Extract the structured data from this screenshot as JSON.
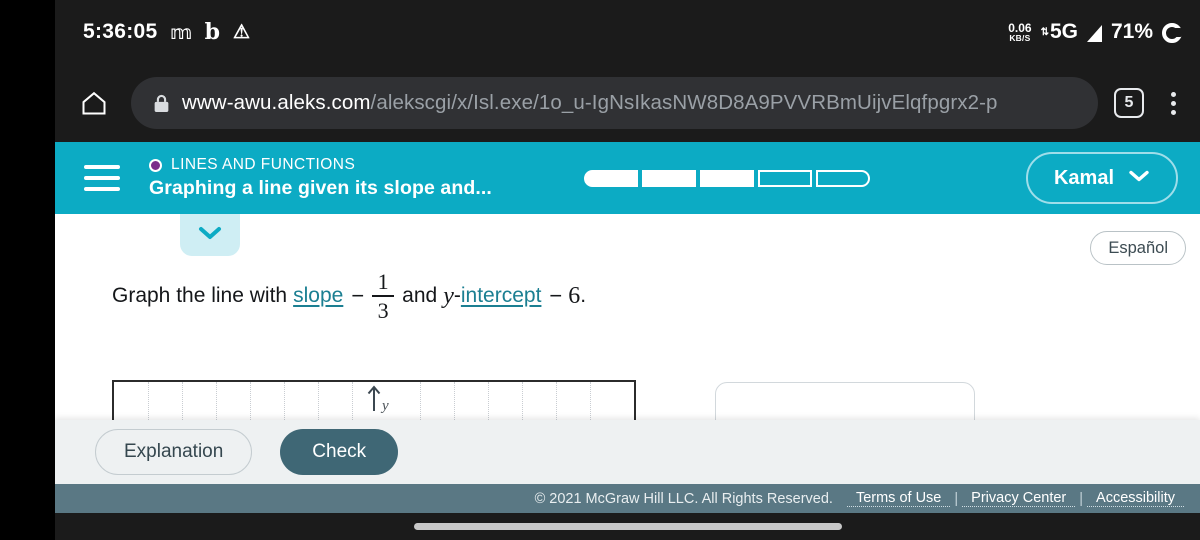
{
  "status_bar": {
    "clock": "5:36:05",
    "icons": [
      "mastodon-icon",
      "b-app-icon",
      "warning-triangle-icon"
    ],
    "net_speed_value": "0.06",
    "net_speed_unit": "KB/S",
    "network_type": "5G",
    "battery_percent": "71%",
    "signal_icon": "signal-triangle-icon",
    "battery_icon": "battery-ring-icon"
  },
  "browser": {
    "home_icon": "home-icon",
    "lock_icon": "lock-icon",
    "url_host": "www-awu.aleks.com",
    "url_path": "/alekscgi/x/Isl.exe/1o_u-IgNsIkasNW8D8A9PVVRBmUijvElqfpgrx2-p",
    "tab_count": "5",
    "menu_icon": "kebab-menu-icon"
  },
  "app_header": {
    "menu_icon": "hamburger-menu-icon",
    "topic_bullet": "purple-dot-icon",
    "topic": "LINES AND FUNCTIONS",
    "problem_title": "Graphing a line given its slope and...",
    "progress": {
      "total": 5,
      "completed": 3,
      "segments": [
        "filled",
        "filled",
        "filled",
        "empty",
        "empty"
      ]
    },
    "user_name": "Kamal",
    "user_chevron": "chevron-down-icon",
    "accent_color": "#0cabc4"
  },
  "content": {
    "collapse_chevron": "chevron-down-icon",
    "language_button": "Español",
    "question": {
      "prefix": "Graph the line with",
      "slope_link": "slope",
      "slope_sign": "−",
      "slope_numerator": "1",
      "slope_denominator": "3",
      "conjunction": "and",
      "y_variable": "y",
      "intercept_prefix": "-",
      "intercept_link": "intercept",
      "intercept_sign": "−",
      "intercept_value": "6",
      "period": "."
    },
    "graph": {
      "y_axis_label": "y",
      "y_axis_arrow": "up-arrow-icon"
    }
  },
  "toolbar": {
    "explanation_label": "Explanation",
    "check_label": "Check",
    "check_color": "#3f6775"
  },
  "footer": {
    "copyright": "© 2021 McGraw Hill LLC. All Rights Reserved.",
    "links": [
      "Terms of Use",
      "Privacy Center",
      "Accessibility"
    ],
    "separator": "|",
    "background_color": "#5a7884"
  },
  "android_nav": {
    "gesture_pill": "gesture-nav-pill"
  }
}
